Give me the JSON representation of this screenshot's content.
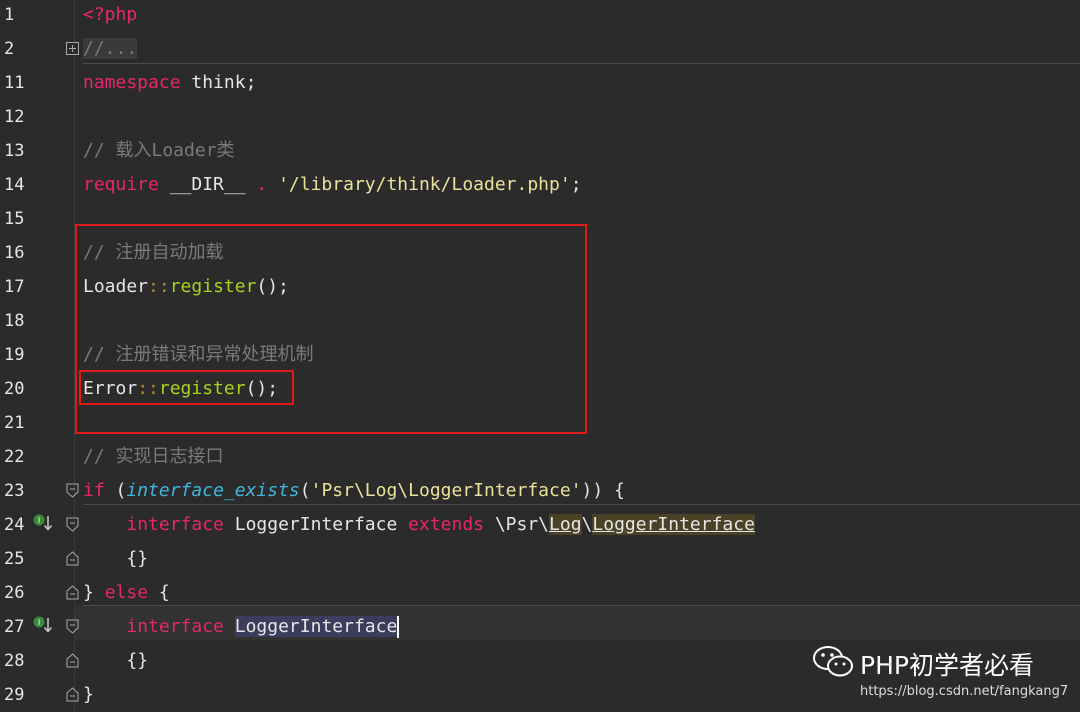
{
  "editor": {
    "lines": [
      {
        "num": "1"
      },
      {
        "num": "2"
      },
      {
        "num": "11"
      },
      {
        "num": "12"
      },
      {
        "num": "13"
      },
      {
        "num": "14"
      },
      {
        "num": "15"
      },
      {
        "num": "16"
      },
      {
        "num": "17"
      },
      {
        "num": "18"
      },
      {
        "num": "19"
      },
      {
        "num": "20"
      },
      {
        "num": "21"
      },
      {
        "num": "22"
      },
      {
        "num": "23"
      },
      {
        "num": "24"
      },
      {
        "num": "25"
      },
      {
        "num": "26"
      },
      {
        "num": "27"
      },
      {
        "num": "28"
      },
      {
        "num": "29"
      }
    ],
    "code": {
      "php_open": "<?php",
      "folded": "//...",
      "namespace_kw": "namespace",
      "namespace_rest": " think;",
      "comment_loader": "// 载入Loader类",
      "require_kw": "require",
      "require_mid": " __DIR__ ",
      "require_dot": ".",
      "require_str": " '/library/think/Loader.php'",
      "require_end": ";",
      "comment_autoload": "// 注册自动加载",
      "loader_class": "Loader",
      "double_colon": "::",
      "register_fn": "register",
      "call_end": "();",
      "comment_error": "// 注册错误和异常处理机制",
      "error_class": "Error",
      "comment_log": "// 实现日志接口",
      "if_kw": "if",
      "paren_open": " (",
      "interface_exists": "interface_exists",
      "if_str": "'Psr\\Log\\LoggerInterface'",
      "if_end": ")) {",
      "interface_kw": "interface",
      "logger_interface": " LoggerInterface ",
      "extends_kw": "extends",
      "psr_ns": " \\Psr\\",
      "log_ref": "Log",
      "backslash": "\\",
      "logger_ref": "LoggerInterface",
      "braces": "{}",
      "else_open": "} ",
      "else_kw": "else",
      "else_brace": " {",
      "logger_sel": "LoggerInterface",
      "close_brace": "}"
    }
  },
  "watermark": {
    "title": "PHP初学者必看",
    "url": "https://blog.csdn.net/fangkang7"
  },
  "colors": {
    "background": "#2b2b2b",
    "keyword": "#e8266d",
    "comment": "#7a7a7a",
    "function": "#a6d41a",
    "string": "#eae29a",
    "highlight_box": "#e01a1a"
  }
}
